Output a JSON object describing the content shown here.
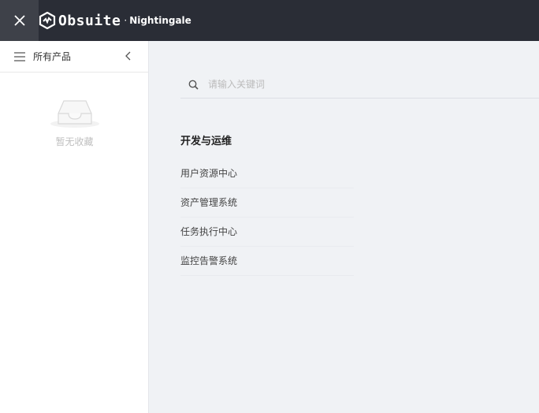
{
  "topbar": {
    "brand_name": "Obsuite",
    "brand_separator": "·",
    "brand_sub": "Nightingale",
    "icons": {
      "close": "close-icon",
      "logo": "logo-icon"
    }
  },
  "sidebar": {
    "title": "所有产品",
    "empty_text": "暂无收藏",
    "icons": {
      "menu": "menu-icon",
      "collapse": "chevron-left-icon",
      "empty": "empty-inbox-icon"
    }
  },
  "search": {
    "placeholder": "请输入关键词"
  },
  "section": {
    "title": "开发与运维",
    "items": [
      {
        "label": "用户资源中心"
      },
      {
        "label": "资产管理系统"
      },
      {
        "label": "任务执行中心"
      },
      {
        "label": "监控告警系统"
      }
    ]
  },
  "colors": {
    "topbar_bg": "#2a2d36",
    "close_bg": "#3e4149",
    "main_bg": "#f0f2f5",
    "sidebar_bg": "#ffffff"
  }
}
